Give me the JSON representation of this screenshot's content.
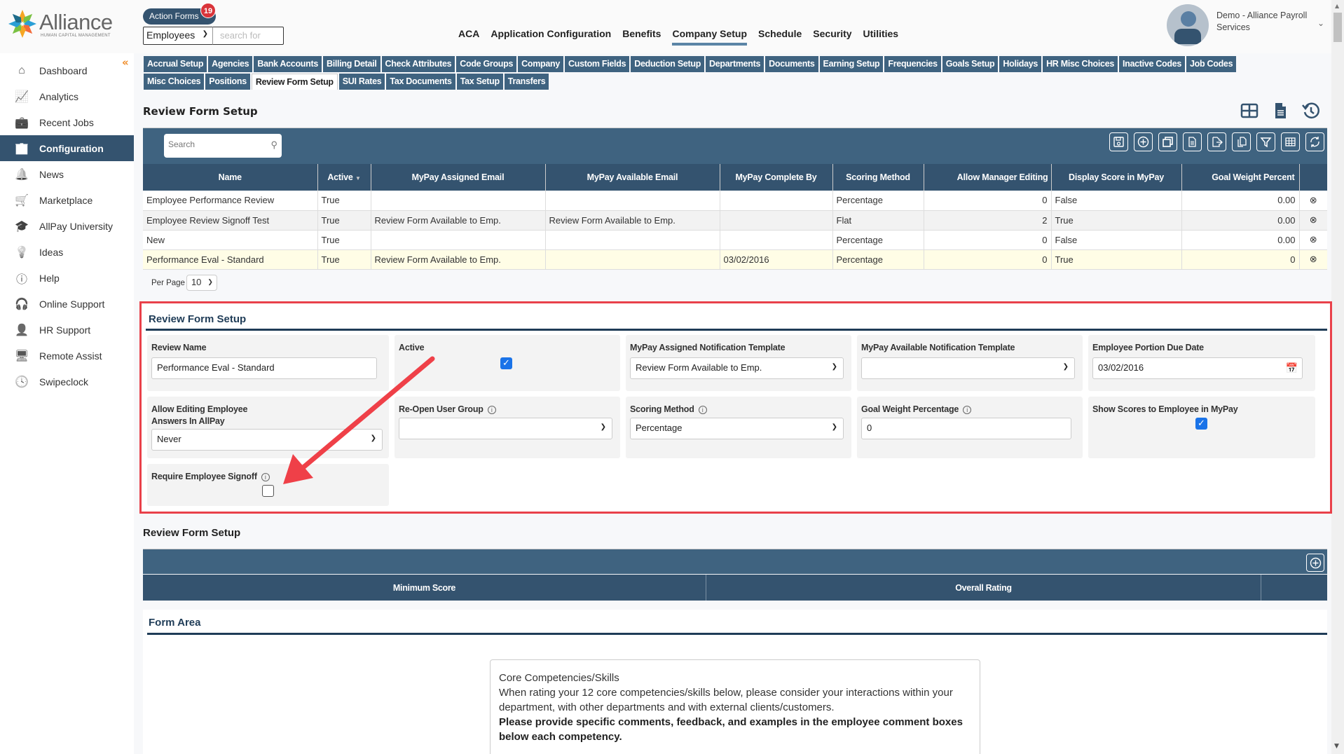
{
  "app": {
    "logo_name": "Alliance",
    "logo_sub": "HUMAN CAPITAL MANAGEMENT",
    "action_forms_label": "Action Forms",
    "action_forms_count": "19",
    "search_scope": "Employees",
    "search_placeholder": "search for",
    "top_nav": [
      {
        "label": "ACA",
        "active": false
      },
      {
        "label": "Application Configuration",
        "active": false
      },
      {
        "label": "Benefits",
        "active": false
      },
      {
        "label": "Company Setup",
        "active": true
      },
      {
        "label": "Schedule",
        "active": false
      },
      {
        "label": "Security",
        "active": false
      },
      {
        "label": "Utilities",
        "active": false
      }
    ],
    "user_name": "Demo - Alliance Payroll Services"
  },
  "sidebar": {
    "items": [
      {
        "label": "Dashboard",
        "icon": "home-icon"
      },
      {
        "label": "Analytics",
        "icon": "analytics-icon"
      },
      {
        "label": "Recent Jobs",
        "icon": "briefcase-icon"
      },
      {
        "label": "Configuration",
        "icon": "building-icon",
        "active": true
      },
      {
        "label": "News",
        "icon": "bell-icon"
      },
      {
        "label": "Marketplace",
        "icon": "basket-icon"
      },
      {
        "label": "AllPay University",
        "icon": "graduation-cap-icon"
      },
      {
        "label": "Ideas",
        "icon": "lightbulb-icon"
      },
      {
        "label": "Help",
        "icon": "question-icon"
      },
      {
        "label": "Online Support",
        "icon": "headset-icon"
      },
      {
        "label": "HR Support",
        "icon": "person-icon"
      },
      {
        "label": "Remote Assist",
        "icon": "monitor-icon"
      },
      {
        "label": "Swipeclock",
        "icon": "clock-icon"
      }
    ]
  },
  "subtabs": {
    "row1": [
      "Accrual Setup",
      "Agencies",
      "Bank Accounts",
      "Billing Detail",
      "Check Attributes",
      "Code Groups",
      "Company",
      "Custom Fields",
      "Deduction Setup",
      "Departments",
      "Documents",
      "Earning Setup",
      "Frequencies",
      "Goals Setup",
      "Holidays",
      "HR Misc Choices",
      "Inactive Codes",
      "Job Codes"
    ],
    "row2": [
      "Misc Choices",
      "Positions",
      "Review Form Setup",
      "SUI Rates",
      "Tax Documents",
      "Tax Setup",
      "Transfers"
    ],
    "active": "Review Form Setup"
  },
  "page": {
    "title": "Review Form Setup"
  },
  "grid": {
    "search_placeholder": "Search",
    "columns": [
      "Name",
      "Active",
      "MyPay Assigned Email",
      "MyPay Available Email",
      "MyPay Complete By",
      "Scoring Method",
      "Allow Manager Editing",
      "Display Score in MyPay",
      "Goal Weight Percent"
    ],
    "sort_indicator": "▼",
    "rows": [
      [
        "Employee Performance Review",
        "True",
        "",
        "",
        "",
        "Percentage",
        "0",
        "False",
        "0.00"
      ],
      [
        "Employee Review Signoff Test",
        "True",
        "Review Form Available to Emp.",
        "Review Form Available to Emp.",
        "",
        "Flat",
        "2",
        "True",
        "0.00"
      ],
      [
        "New",
        "True",
        "",
        "",
        "",
        "Percentage",
        "0",
        "False",
        "0.00"
      ],
      [
        "Performance Eval - Standard",
        "True",
        "Review Form Available to Emp.",
        "",
        "03/02/2016",
        "Percentage",
        "0",
        "True",
        "0"
      ]
    ],
    "per_page_label": "Per Page",
    "per_page_value": "10"
  },
  "form": {
    "title": "Review Form Setup",
    "review_name_label": "Review Name",
    "review_name_value": "Performance Eval - Standard",
    "active_label": "Active",
    "active_checked": true,
    "assigned_template_label": "MyPay Assigned Notification Template",
    "assigned_template_value": "Review Form Available to Emp.",
    "available_template_label": "MyPay Available Notification Template",
    "available_template_value": "",
    "due_date_label": "Employee Portion Due Date",
    "due_date_value": "03/02/2016",
    "allow_editing_label_1": "Allow Editing Employee",
    "allow_editing_label_2": "Answers In AllPay",
    "allow_editing_value": "Never",
    "reopen_group_label": "Re-Open User Group",
    "reopen_group_value": "",
    "scoring_method_label": "Scoring Method",
    "scoring_method_value": "Percentage",
    "goal_weight_label": "Goal Weight Percentage",
    "goal_weight_value": "0",
    "show_scores_label": "Show Scores to Employee in MyPay",
    "show_scores_checked": true,
    "require_signoff_label": "Require Employee Signoff",
    "require_signoff_checked": false
  },
  "rating": {
    "title": "Review Form Setup",
    "columns": [
      "Minimum Score",
      "Overall Rating"
    ]
  },
  "form_area": {
    "title": "Form Area",
    "heading": "Core Competencies/Skills",
    "body": "When rating your 12 core competencies/skills below, please consider your interactions within your department, with other departments and with external clients/customers.",
    "bold": "Please provide specific comments, feedback, and examples in the employee comment boxes below each competency."
  },
  "colors": {
    "primary": "#34536f",
    "toolbar": "#3f6380",
    "highlight_box": "#e9414a",
    "accent_orange": "#f08a24",
    "checkbox": "#1a73e8"
  }
}
